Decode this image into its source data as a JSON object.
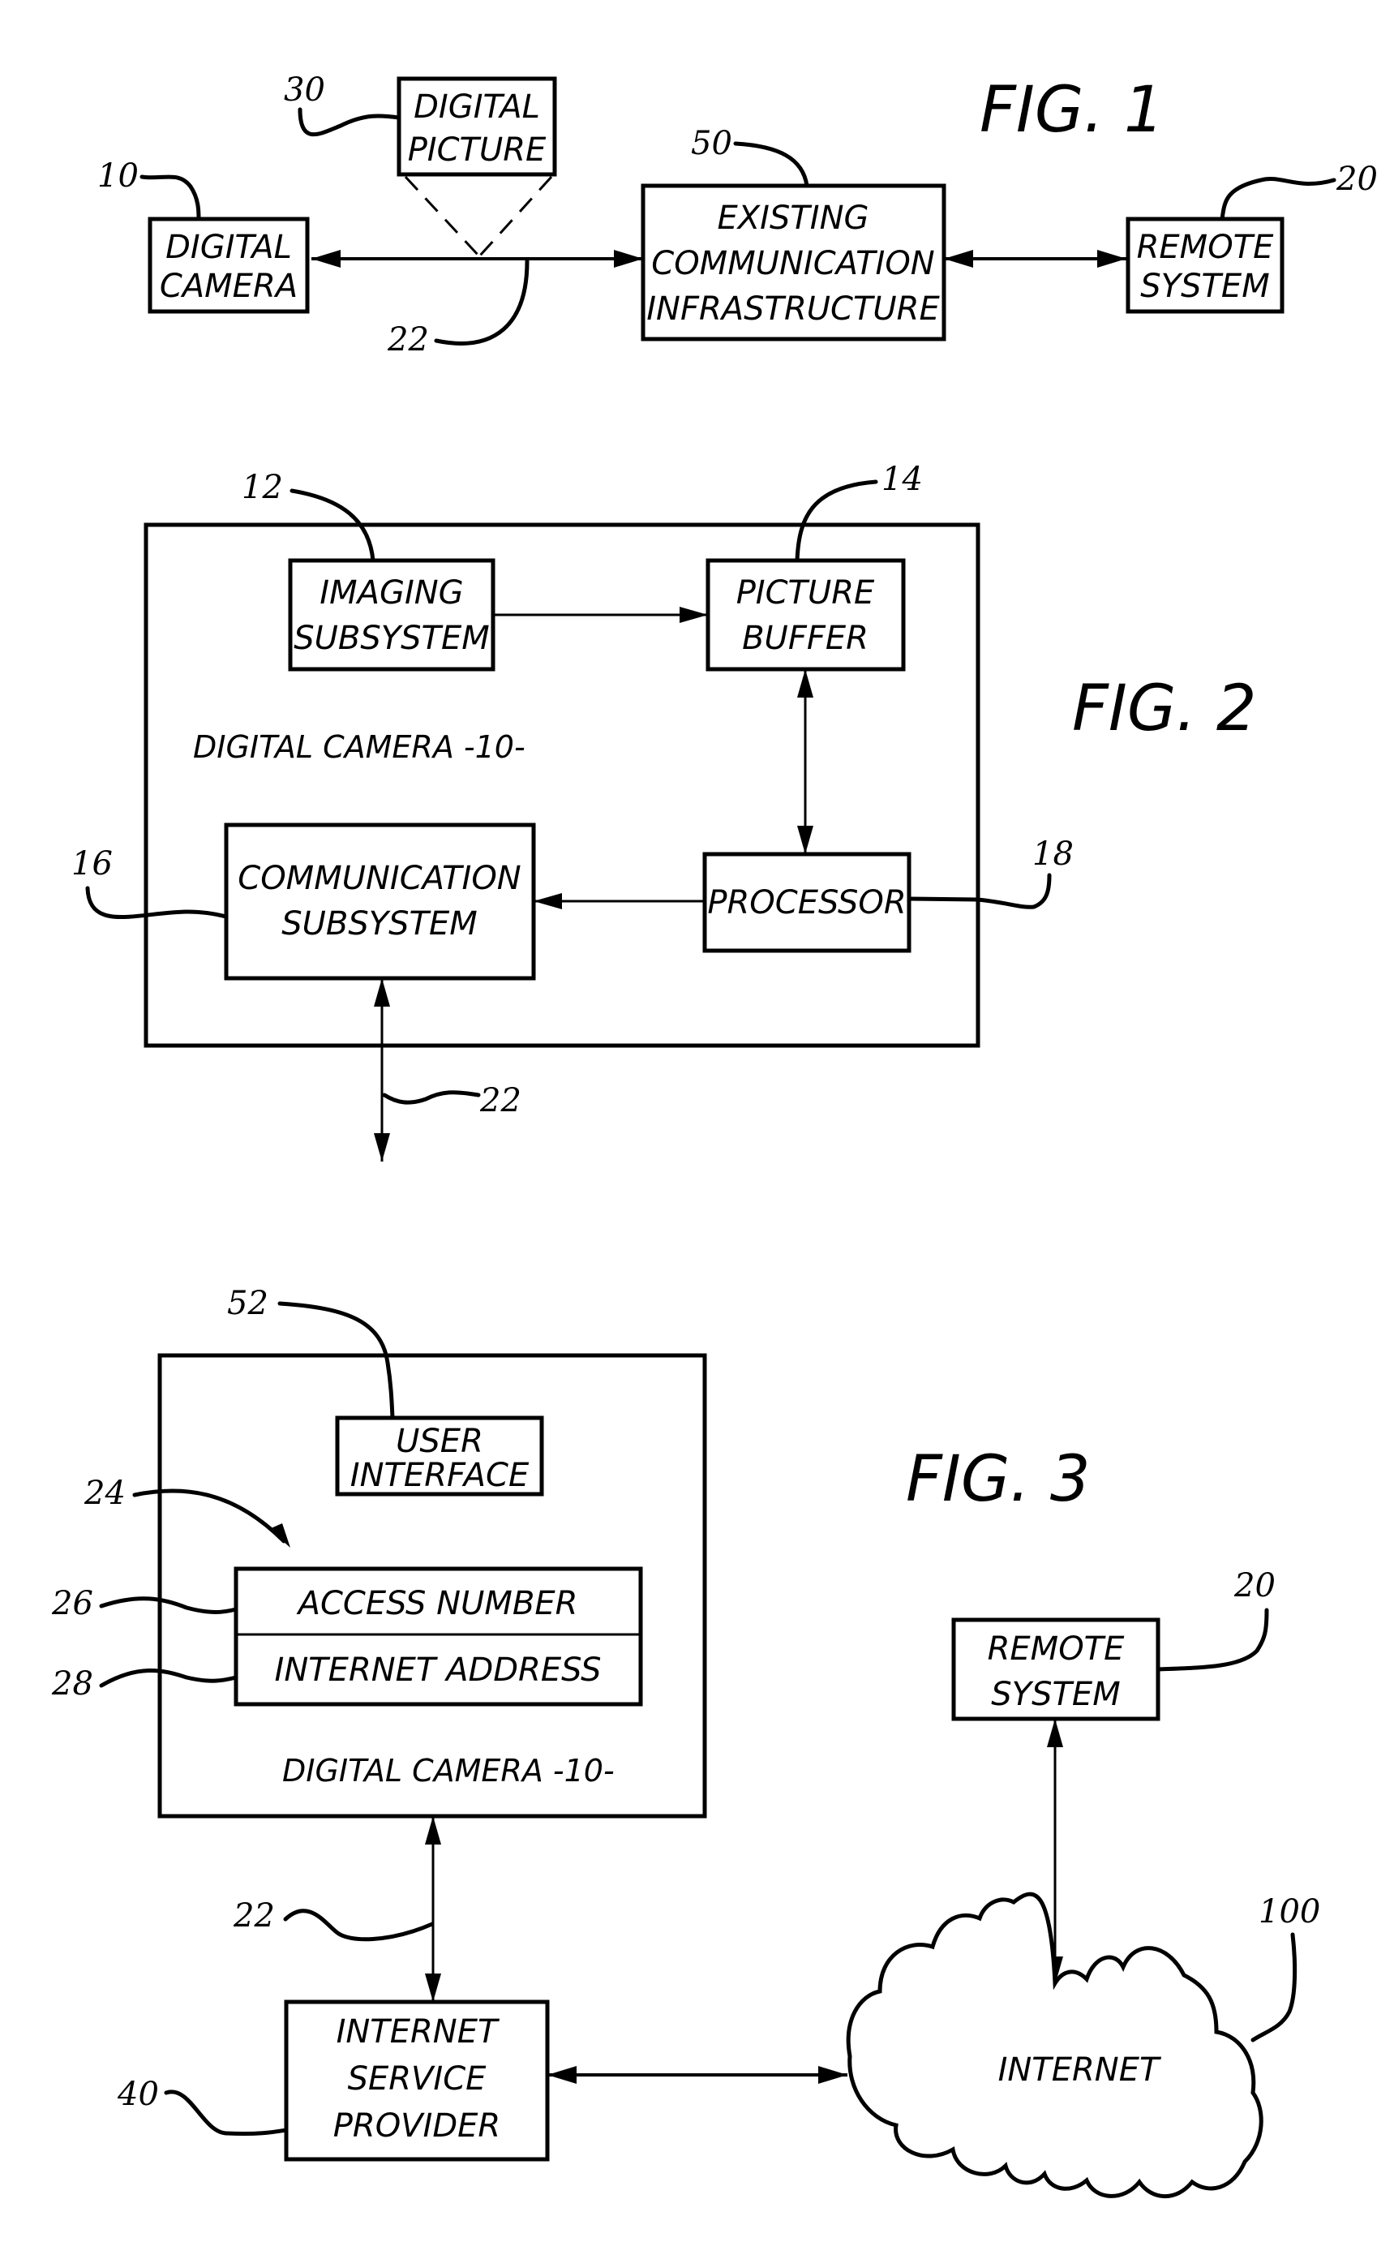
{
  "figures": {
    "fig1": {
      "title": "FIG. 1",
      "boxes": {
        "digital_camera": [
          "DIGITAL",
          "CAMERA"
        ],
        "digital_picture": [
          "DIGITAL",
          "PICTURE"
        ],
        "existing_infrastructure": [
          "EXISTING",
          "COMMUNICATION",
          "INFRASTRUCTURE"
        ],
        "remote_system": [
          "REMOTE",
          "SYSTEM"
        ]
      },
      "refs": {
        "digital_camera": "10",
        "digital_picture": "30",
        "link": "22",
        "existing_infrastructure": "50",
        "remote_system": "20"
      }
    },
    "fig2": {
      "title": "FIG. 2",
      "container_caption": "DIGITAL CAMERA -10-",
      "boxes": {
        "imaging_subsystem": [
          "IMAGING",
          "SUBSYSTEM"
        ],
        "picture_buffer": [
          "PICTURE",
          "BUFFER"
        ],
        "communication_subsystem": [
          "COMMUNICATION",
          "SUBSYSTEM"
        ],
        "processor": [
          "PROCESSOR"
        ]
      },
      "refs": {
        "imaging_subsystem": "12",
        "picture_buffer": "14",
        "communication_subsystem": "16",
        "processor": "18",
        "link": "22"
      }
    },
    "fig3": {
      "title": "FIG. 3",
      "container_caption": "DIGITAL CAMERA -10-",
      "boxes": {
        "user_interface": [
          "USER",
          "INTERFACE"
        ],
        "access_number": "ACCESS NUMBER",
        "internet_address": "INTERNET ADDRESS",
        "remote_system": [
          "REMOTE",
          "SYSTEM"
        ],
        "isp": [
          "INTERNET",
          "SERVICE",
          "PROVIDER"
        ],
        "internet": "INTERNET"
      },
      "refs": {
        "user_interface": "52",
        "register": "24",
        "access_number": "26",
        "internet_address": "28",
        "link": "22",
        "isp": "40",
        "remote_system": "20",
        "internet": "100"
      }
    }
  }
}
